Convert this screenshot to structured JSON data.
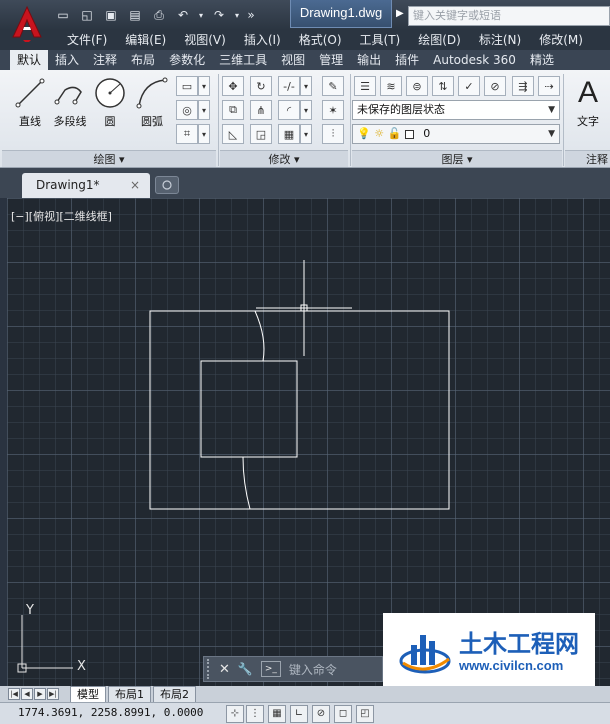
{
  "title_bar": {
    "document_title": "Drawing1.dwg",
    "search_placeholder": "键入关键字或短语",
    "qat_icons": [
      "new-icon",
      "open-icon",
      "save-icon",
      "saveas-icon",
      "print-icon",
      "undo-icon",
      "redo-icon",
      "more-icon"
    ]
  },
  "menubar": {
    "items": [
      "文件(F)",
      "编辑(E)",
      "视图(V)",
      "插入(I)",
      "格式(O)",
      "工具(T)",
      "绘图(D)",
      "标注(N)",
      "修改(M)"
    ]
  },
  "ribbon_tabs": {
    "items": [
      "默认",
      "插入",
      "注释",
      "布局",
      "参数化",
      "三维工具",
      "视图",
      "管理",
      "输出",
      "插件",
      "Autodesk 360",
      "精选"
    ],
    "active": "默认"
  },
  "ribbon": {
    "draw": {
      "title": "绘图",
      "tools": [
        "直线",
        "多段线",
        "圆",
        "圆弧"
      ]
    },
    "modify": {
      "title": "修改"
    },
    "layers": {
      "title": "图层",
      "layer_state": "未保存的图层状态",
      "current_layer": "0"
    },
    "annotation": {
      "title": "注释",
      "text_tool": "文字"
    }
  },
  "doc_tabs": {
    "active_tab": "Drawing1*",
    "close_glyph": "×"
  },
  "canvas": {
    "viewport_label": "[−][俯视][二维线框]",
    "ucs_x": "X",
    "ucs_y": "Y"
  },
  "command_line": {
    "placeholder": "键入命令",
    "prompt_icon": ">_"
  },
  "layout_tabs": {
    "items": [
      "模型",
      "布局1",
      "布局2"
    ],
    "active": "模型"
  },
  "statusbar": {
    "coordinates": "1774.3691, 2258.8991, 0.0000"
  },
  "watermark": {
    "cn_text": "土木工程网",
    "url_text": "www.civilcn.com"
  },
  "colors": {
    "titlebar_bg": "#2b3541",
    "canvas_bg": "#212830",
    "ribbon_bg": "#e9edf2",
    "accent_red": "#c8141e",
    "watermark_blue": "#1d5fb8"
  }
}
